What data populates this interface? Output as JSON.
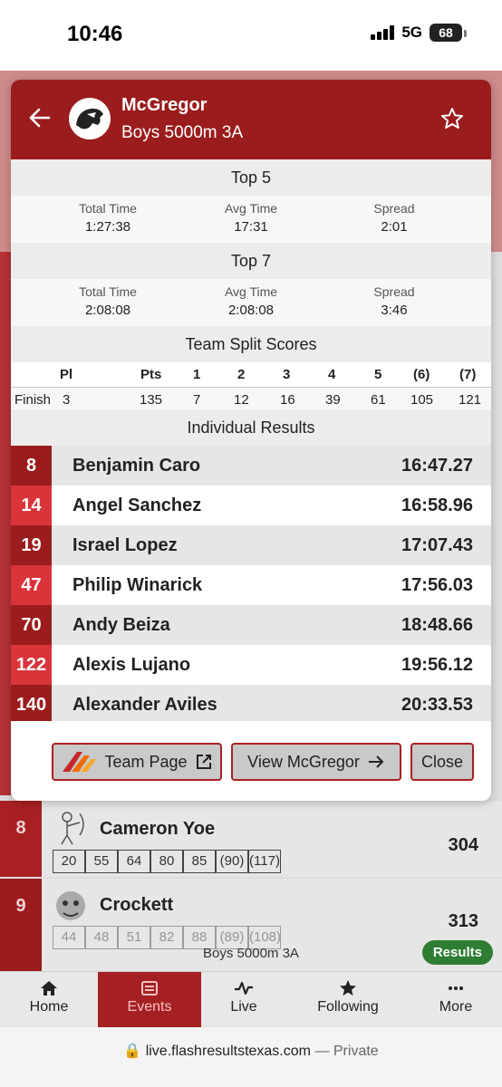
{
  "status_bar": {
    "time": "10:46",
    "network": "5G",
    "battery": "68"
  },
  "modal": {
    "team_name": "McGregor",
    "event_name": "Boys 5000m 3A",
    "top5": {
      "heading": "Top 5",
      "total_label": "Total Time",
      "total_value": "1:27:38",
      "avg_label": "Avg Time",
      "avg_value": "17:31",
      "spread_label": "Spread",
      "spread_value": "2:01"
    },
    "top7": {
      "heading": "Top 7",
      "total_label": "Total Time",
      "total_value": "2:08:08",
      "avg_label": "Avg Time",
      "avg_value": "2:08:08",
      "spread_label": "Spread",
      "spread_value": "3:46"
    },
    "split_scores": {
      "heading": "Team Split Scores",
      "headers": [
        "Pl",
        "Pts",
        "1",
        "2",
        "3",
        "4",
        "5",
        "(6)",
        "(7)"
      ],
      "row_label": "Finish",
      "row": [
        "3",
        "135",
        "7",
        "12",
        "16",
        "39",
        "61",
        "105",
        "121"
      ]
    },
    "individual": {
      "heading": "Individual Results",
      "rows": [
        {
          "place": "8",
          "name": "Benjamin Caro",
          "time": "16:47.27"
        },
        {
          "place": "14",
          "name": "Angel Sanchez",
          "time": "16:58.96"
        },
        {
          "place": "19",
          "name": "Israel Lopez",
          "time": "17:07.43"
        },
        {
          "place": "47",
          "name": "Philip Winarick",
          "time": "17:56.03"
        },
        {
          "place": "70",
          "name": "Andy Beiza",
          "time": "18:48.66"
        },
        {
          "place": "122",
          "name": "Alexis Lujano",
          "time": "19:56.12"
        },
        {
          "place": "140",
          "name": "Alexander Aviles",
          "time": "20:33.53"
        }
      ]
    },
    "buttons": {
      "team_page": "Team Page",
      "view_team": "View McGregor",
      "close": "Close"
    }
  },
  "background": {
    "rows": [
      {
        "rank": "8",
        "team": "Cameron Yoe",
        "score": "304",
        "splits": [
          "20",
          "55",
          "64",
          "80",
          "85",
          "(90)",
          "(117)"
        ]
      },
      {
        "rank": "9",
        "team": "Crockett",
        "score": "313",
        "splits": [
          "44",
          "48",
          "51",
          "82",
          "88",
          "(89)",
          "(108)"
        ]
      }
    ],
    "event_caption": "Boys 5000m 3A",
    "results_badge": "Results"
  },
  "nav": {
    "home": "Home",
    "events": "Events",
    "live": "Live",
    "following": "Following",
    "more": "More"
  },
  "url_bar": {
    "domain": "live.flashresultstexas.com",
    "suffix": "— Private"
  },
  "colors": {
    "primary": "#9b1c1c",
    "rank_dark": "#9b1c1c",
    "rank_light": "#d8343a",
    "green": "#2e7d32"
  }
}
